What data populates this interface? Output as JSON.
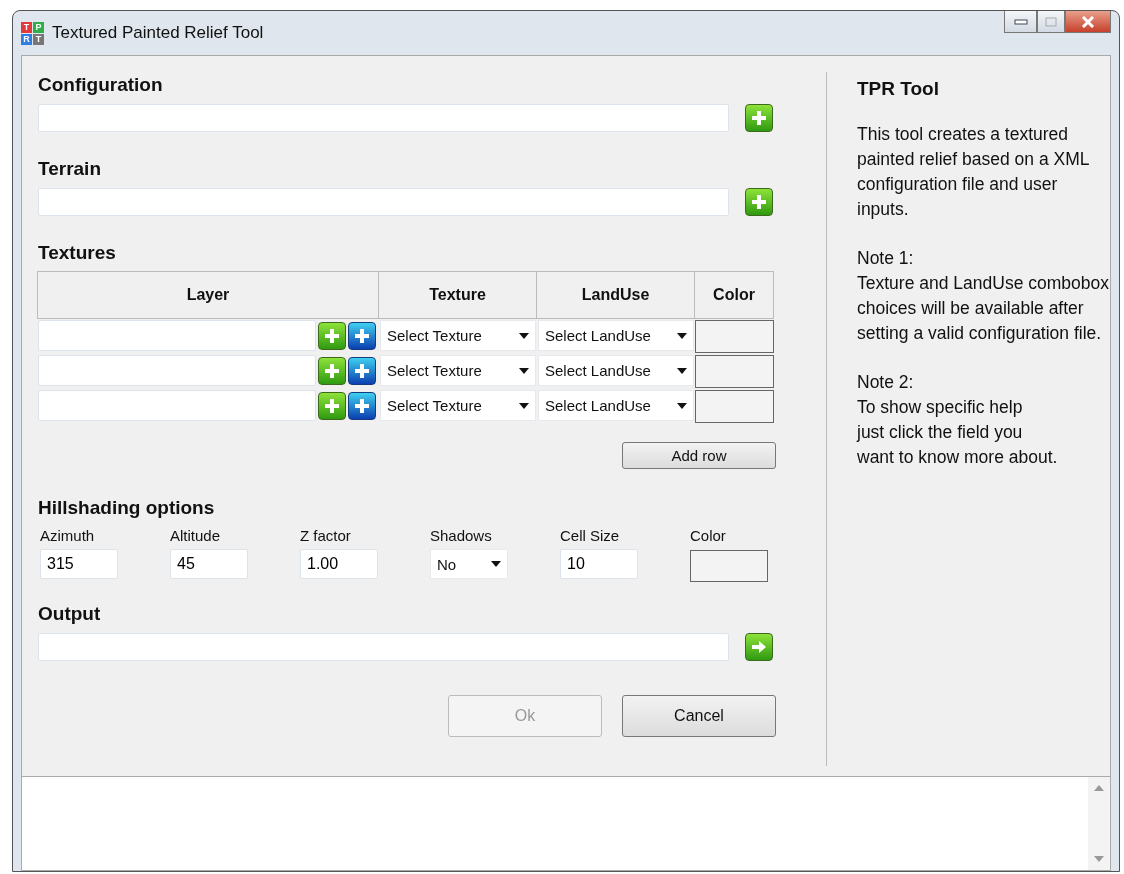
{
  "window": {
    "title": "Textured Painted Relief Tool",
    "logo_letters": [
      "T",
      "P",
      "R",
      "T"
    ]
  },
  "configuration": {
    "heading": "Configuration"
  },
  "terrain": {
    "heading": "Terrain"
  },
  "textures": {
    "heading": "Textures",
    "columns": [
      "Layer",
      "Texture",
      "LandUse",
      "Color"
    ],
    "rows": [
      {
        "texture": "Select Texture",
        "landuse": "Select LandUse"
      },
      {
        "texture": "Select Texture",
        "landuse": "Select LandUse"
      },
      {
        "texture": "Select Texture",
        "landuse": "Select LandUse"
      }
    ],
    "add_row": "Add row"
  },
  "hillshading": {
    "heading": "Hillshading options",
    "fields": [
      {
        "kind": "input",
        "label": "Azimuth",
        "value": "315"
      },
      {
        "kind": "input",
        "label": "Altitude",
        "value": "45"
      },
      {
        "kind": "input",
        "label": "Z factor",
        "value": "1.00"
      },
      {
        "kind": "select",
        "label": "Shadows",
        "value": "No"
      },
      {
        "kind": "input",
        "label": "Cell Size",
        "value": "10"
      },
      {
        "kind": "color",
        "label": "Color"
      }
    ]
  },
  "output": {
    "heading": "Output"
  },
  "buttons": [
    {
      "label": "Ok",
      "disabled": true
    },
    {
      "label": "Cancel",
      "disabled": false
    }
  ],
  "help": {
    "title": "TPR Tool",
    "paragraphs": [
      "This tool creates a textured painted relief based on a XML configuration file and user inputs.",
      "Note 1:\nTexture and LandUse combobox choices will be available after setting a valid configuration file.",
      "Note 2:\nTo show specific help\njust click the field you\nwant to know more about."
    ]
  }
}
